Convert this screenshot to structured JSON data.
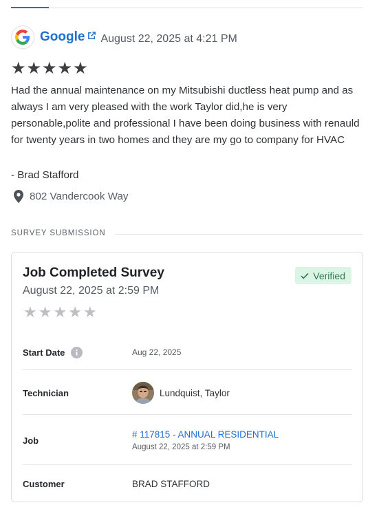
{
  "review": {
    "source": "Google",
    "source_icon": "google-logo",
    "external_icon": "external-link-icon",
    "date": "August 22, 2025 at 4:21 PM",
    "rating": 5,
    "text": "Had the annual maintenance on my Mitsubishi ductless heat pump and as always I am very pleased with the work Taylor did,he is very personable,polite and professional I have been doing business with renauld for twenty years in two homes and they are my go to company for HVAC",
    "author": "- Brad Stafford",
    "location": "802 Vandercook Way",
    "location_icon": "map-pin-icon"
  },
  "survey_section": {
    "label": "SURVEY SUBMISSION"
  },
  "survey": {
    "title": "Job Completed Survey",
    "date": "August 22, 2025 at 2:59 PM",
    "verified_label": "Verified",
    "rating": 0,
    "fields": {
      "start_date_label": "Start Date",
      "start_date_value": "Aug 22, 2025",
      "technician_label": "Technician",
      "technician_value": "Lundquist, Taylor",
      "job_label": "Job",
      "job_value": "# 117815 - ANNUAL RESIDENTIAL",
      "job_date": "August 22, 2025 at 2:59 PM",
      "customer_label": "Customer",
      "customer_value": "BRAD STAFFORD"
    }
  },
  "colors": {
    "accent": "#1f6fcf",
    "verified_bg": "#dcf4e6",
    "verified_text": "#2a7a4f",
    "star_filled": "#3d3f43",
    "star_empty": "#bdbfc3"
  }
}
